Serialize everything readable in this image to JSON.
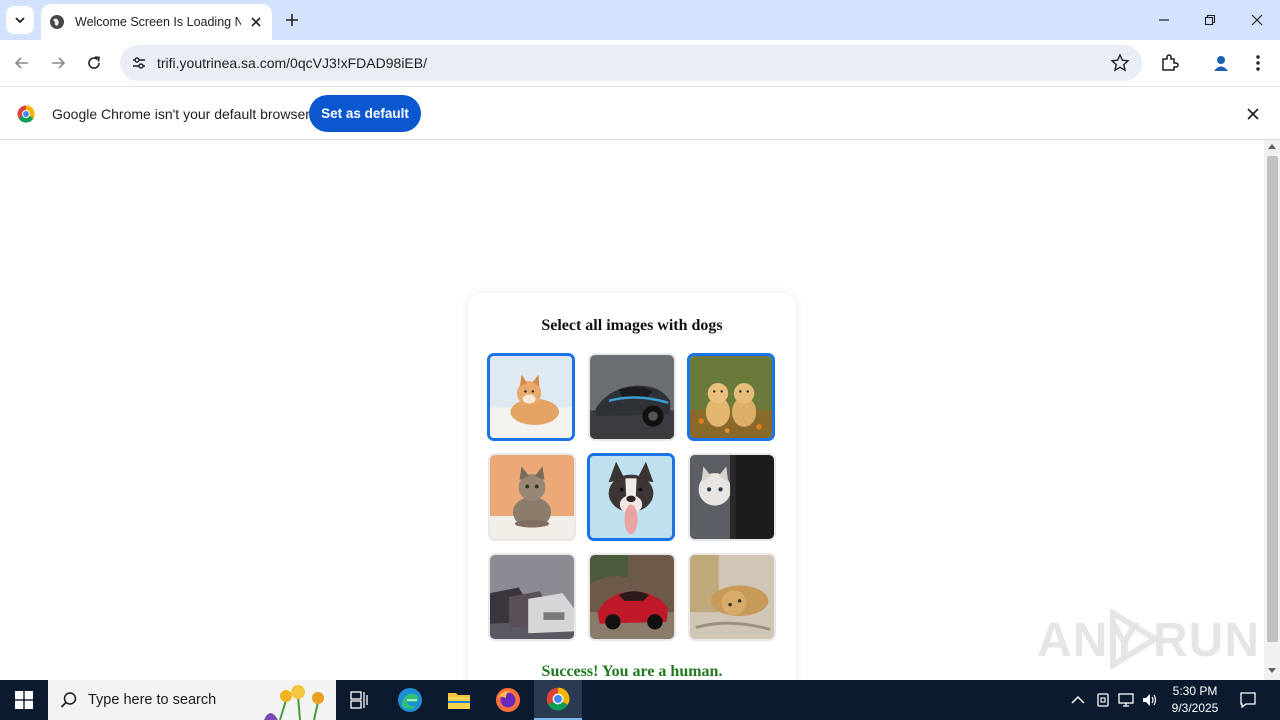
{
  "browser": {
    "tab_title": "Welcome Screen Is Loading No",
    "url": "trifi.youtrinea.sa.com/0qcVJ3!xFDAD98iEB/",
    "infobar_text": "Google Chrome isn't your default browser",
    "infobar_button": "Set as default"
  },
  "page": {
    "captcha_title": "Select all images with dogs",
    "tiles": [
      {
        "subject": "shiba-dog",
        "selected": true
      },
      {
        "subject": "sports-car",
        "selected": false
      },
      {
        "subject": "golden-puppies",
        "selected": true
      },
      {
        "subject": "tabby-cat",
        "selected": false
      },
      {
        "subject": "french-bulldog",
        "selected": true
      },
      {
        "subject": "kitten",
        "selected": false
      },
      {
        "subject": "parked-cars",
        "selected": false
      },
      {
        "subject": "red-sports-car",
        "selected": false
      },
      {
        "subject": "lying-cat",
        "selected": false
      }
    ],
    "success_message": "Success! You are a human."
  },
  "watermark": {
    "left": "ANY",
    "right": "RUN"
  },
  "taskbar": {
    "search_placeholder": "Type here to search",
    "time": "5:30 PM",
    "date": "9/3/2025"
  },
  "colors": {
    "tabstrip": "#d3e3fd",
    "accent": "#0b57d0",
    "selected_border": "#1a73e8",
    "success": "#1e7a1e",
    "taskbar": "#0b1a2e"
  }
}
